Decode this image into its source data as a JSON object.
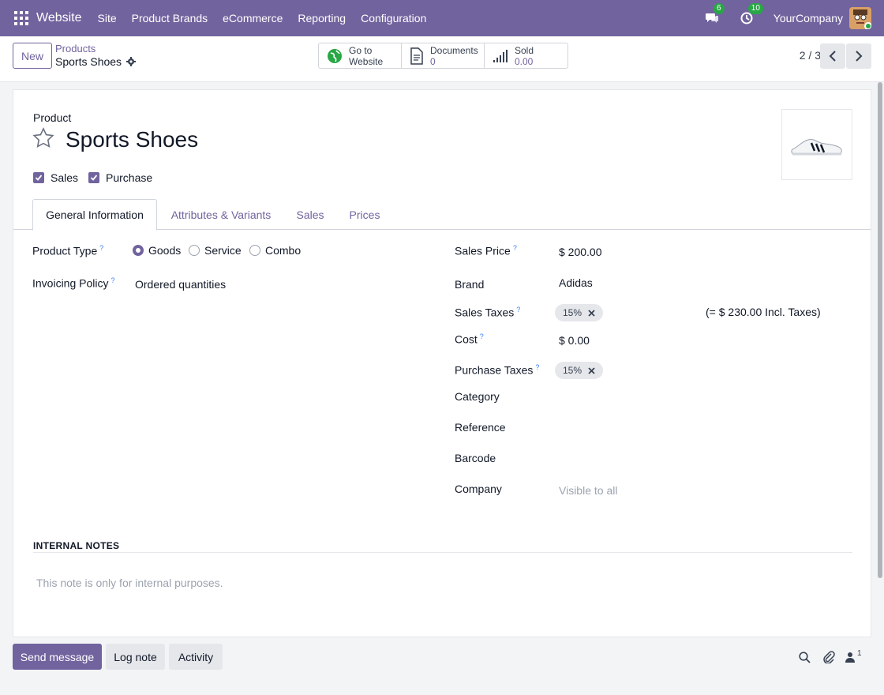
{
  "navbar": {
    "app_name": "Website",
    "menu": [
      "Site",
      "Product Brands",
      "eCommerce",
      "Reporting",
      "Configuration"
    ],
    "messages_count": "6",
    "activities_count": "10",
    "company": "YourCompany"
  },
  "control": {
    "new_label": "New",
    "breadcrumb": "Products",
    "record_name": "Sports Shoes",
    "stats": [
      {
        "label": "Go to",
        "label2": "Website",
        "value": ""
      },
      {
        "label": "Documents",
        "value": "0"
      },
      {
        "label": "Sold",
        "value": "0.00"
      }
    ],
    "pager": "2 / 3"
  },
  "form": {
    "product_label": "Product",
    "name": "Sports Shoes",
    "sales_label": "Sales",
    "purchase_label": "Purchase",
    "tabs": [
      "General Information",
      "Attributes & Variants",
      "Sales",
      "Prices"
    ],
    "left": {
      "product_type_label": "Product Type",
      "product_type_options": [
        "Goods",
        "Service",
        "Combo"
      ],
      "invoicing_policy_label": "Invoicing Policy",
      "invoicing_policy_value": "Ordered quantities"
    },
    "right": {
      "sales_price_label": "Sales Price",
      "sales_price_value": "$ 200.00",
      "brand_label": "Brand",
      "brand_value": "Adidas",
      "sales_taxes_label": "Sales Taxes",
      "sales_taxes_tag": "15%",
      "sales_taxes_incl": "(= $ 230.00 Incl. Taxes)",
      "cost_label": "Cost",
      "cost_value": "$ 0.00",
      "purchase_taxes_label": "Purchase Taxes",
      "purchase_taxes_tag": "15%",
      "category_label": "Category",
      "reference_label": "Reference",
      "barcode_label": "Barcode",
      "company_label": "Company",
      "company_placeholder": "Visible to all"
    },
    "notes_title": "INTERNAL NOTES",
    "notes_placeholder": "This note is only for internal purposes."
  },
  "chatter": {
    "send_message": "Send message",
    "log_note": "Log note",
    "activity": "Activity",
    "followers_count": "1"
  },
  "colors": {
    "brand": "#71639e",
    "badge": "#28a745",
    "help": "#3b82f6"
  }
}
